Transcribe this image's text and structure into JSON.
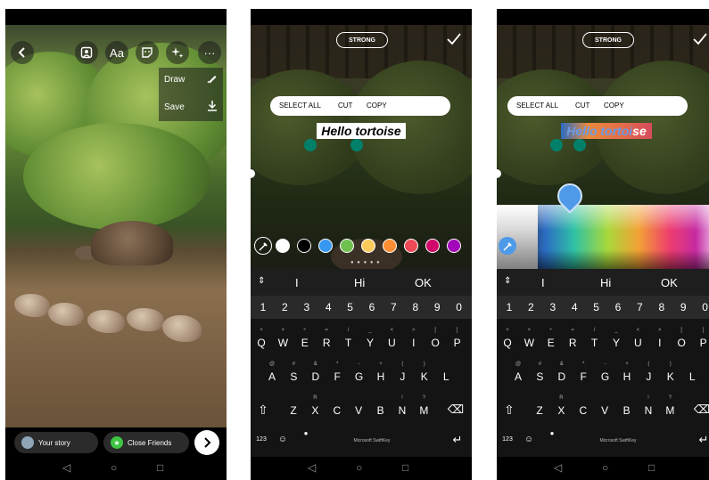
{
  "screen1": {
    "top_bar": {
      "back_icon": "chevron-left-icon",
      "face_icon": "face-filter-icon",
      "text_label": "Aa",
      "sticker_icon": "sticker-icon",
      "effects_icon": "sparkle-icon",
      "more_label": "···"
    },
    "menu": {
      "draw_label": "Draw",
      "draw_icon": "marker-icon",
      "save_label": "Save",
      "save_icon": "download-icon"
    },
    "bottom": {
      "your_story_label": "Your story",
      "close_friends_label": "Close Friends",
      "next_icon": "chevron-right-icon"
    },
    "nav": {
      "back": "◁",
      "home": "○",
      "recents": "□"
    }
  },
  "editor": {
    "style_pill_label": "STRONG",
    "done_icon": "check-icon",
    "selection_menu": {
      "select_all": "SELECT ALL",
      "cut": "CUT",
      "copy": "COPY"
    },
    "text_content": "Hello tortoise",
    "text_content_colored_parts": [
      "Hello tortoi",
      "se"
    ],
    "palette": [
      "#ffffff",
      "#000000",
      "#3897f0",
      "#70c050",
      "#fdcb5c",
      "#fd8d32",
      "#ed4956",
      "#d10869",
      "#a307ba"
    ],
    "picked_color": "#4e9ae8",
    "suggestions": {
      "expand_icon": "⇕",
      "left": "I",
      "center": "Hi",
      "right": "OK"
    },
    "number_row": [
      "1",
      "2",
      "3",
      "4",
      "5",
      "6",
      "7",
      "8",
      "9",
      "0"
    ],
    "row1": [
      "Q",
      "W",
      "E",
      "R",
      "T",
      "Y",
      "U",
      "I",
      "O",
      "P"
    ],
    "row1_sub": [
      "+",
      "×",
      "÷",
      "=",
      "/",
      "_",
      "<",
      ">",
      "[",
      "]"
    ],
    "row2": [
      "A",
      "S",
      "D",
      "F",
      "G",
      "H",
      "J",
      "K",
      "L"
    ],
    "row2_sub": [
      "@",
      "#",
      "&",
      "*",
      "-",
      "+",
      "(",
      ")",
      ""
    ],
    "row3": [
      "Z",
      "X",
      "C",
      "V",
      "B",
      "N",
      "M"
    ],
    "row3_sub": [
      "",
      "R",
      "",
      "",
      "",
      "!",
      "?"
    ],
    "bottom_row": {
      "num_key": "123",
      "emoji_icon": "emoji-icon",
      "mic_icon": "mic-icon",
      "brand": "Microsoft SwiftKey",
      "enter_icon": "enter-icon"
    },
    "shift_icon": "⇧",
    "backspace_icon": "⌫"
  }
}
